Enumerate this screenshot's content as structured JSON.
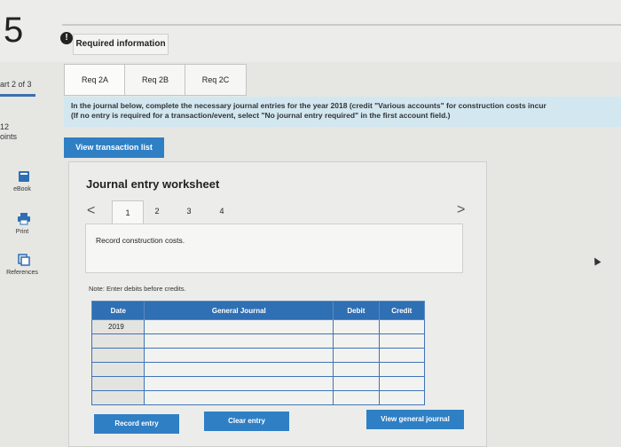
{
  "question_number": "5",
  "required_info_label": "Required information",
  "alert_glyph": "!",
  "sidebar": {
    "part_label": "art 2 of 3",
    "points_value": "12",
    "points_label": "oints",
    "items": [
      {
        "label": "eBook",
        "icon": "book-icon"
      },
      {
        "label": "Print",
        "icon": "printer-icon"
      },
      {
        "label": "References",
        "icon": "copy-icon"
      }
    ]
  },
  "tabs": [
    "Req 2A",
    "Req 2B",
    "Req 2C"
  ],
  "instructions": {
    "line1": "In the journal below, complete the necessary journal entries for the year 2018 (credit \"Various accounts\" for construction costs incur",
    "line2": "(If no entry is required for a transaction/event, select \"No journal entry required\" in the first account field.)"
  },
  "view_transaction_label": "View transaction list",
  "worksheet": {
    "title": "Journal entry worksheet",
    "prev_glyph": "<",
    "next_glyph": ">",
    "pages": [
      "1",
      "2",
      "3",
      "4"
    ],
    "active_page": "1",
    "description": "Record construction costs.",
    "note": "Note: Enter debits before credits.",
    "table": {
      "headers": [
        "Date",
        "General Journal",
        "Debit",
        "Credit"
      ],
      "rows": [
        [
          "2019",
          "",
          "",
          ""
        ],
        [
          "",
          "",
          "",
          ""
        ],
        [
          "",
          "",
          "",
          ""
        ],
        [
          "",
          "",
          "",
          ""
        ],
        [
          "",
          "",
          "",
          ""
        ],
        [
          "",
          "",
          "",
          ""
        ]
      ]
    }
  },
  "buttons": {
    "record": "Record entry",
    "clear": "Clear entry",
    "view_general": "View general journal"
  },
  "colors": {
    "accent": "#2f7fc5",
    "table_header": "#2f6fb3",
    "instruction_bg": "#d2e7f0"
  }
}
